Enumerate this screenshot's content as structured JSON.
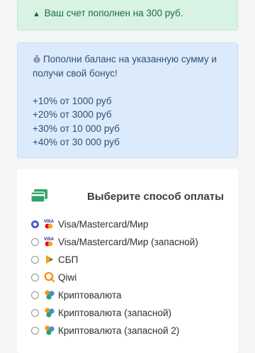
{
  "success_alert": {
    "icon": "warning-icon",
    "text": "Ваш счет пополнен на 300 руб."
  },
  "info_alert": {
    "icon": "moneybag-icon",
    "line1": "Пополни баланс на указанную сумму и",
    "line2": "получи свой бонус!",
    "bonuses": [
      "+10% от 1000 руб",
      "+20% от 3000 руб",
      "+30% от 10 000 руб",
      "+40% от 30 000 руб"
    ]
  },
  "payment": {
    "title": "Выберите способ оплаты",
    "header_icon": "credit-card-icon",
    "methods": [
      {
        "label": "Visa/Mastercard/Мир",
        "icon": "cards-icon",
        "checked": true
      },
      {
        "label": "Visa/Mastercard/Мир (запасной)",
        "icon": "cards-icon",
        "checked": false
      },
      {
        "label": "СБП",
        "icon": "sbp-icon",
        "checked": false
      },
      {
        "label": "Qiwi",
        "icon": "qiwi-icon",
        "checked": false
      },
      {
        "label": "Криптовалюта",
        "icon": "crypto-icon",
        "checked": false
      },
      {
        "label": "Криптовалюта (запасной)",
        "icon": "crypto-icon",
        "checked": false
      },
      {
        "label": "Криптовалюта (запасной 2)",
        "icon": "crypto-icon",
        "checked": false
      }
    ]
  },
  "colors": {
    "success_bg": "#d8f3e3",
    "info_bg": "#dcebfb",
    "accent": "#4f5bd5",
    "card_icon": "#2fa36b"
  }
}
